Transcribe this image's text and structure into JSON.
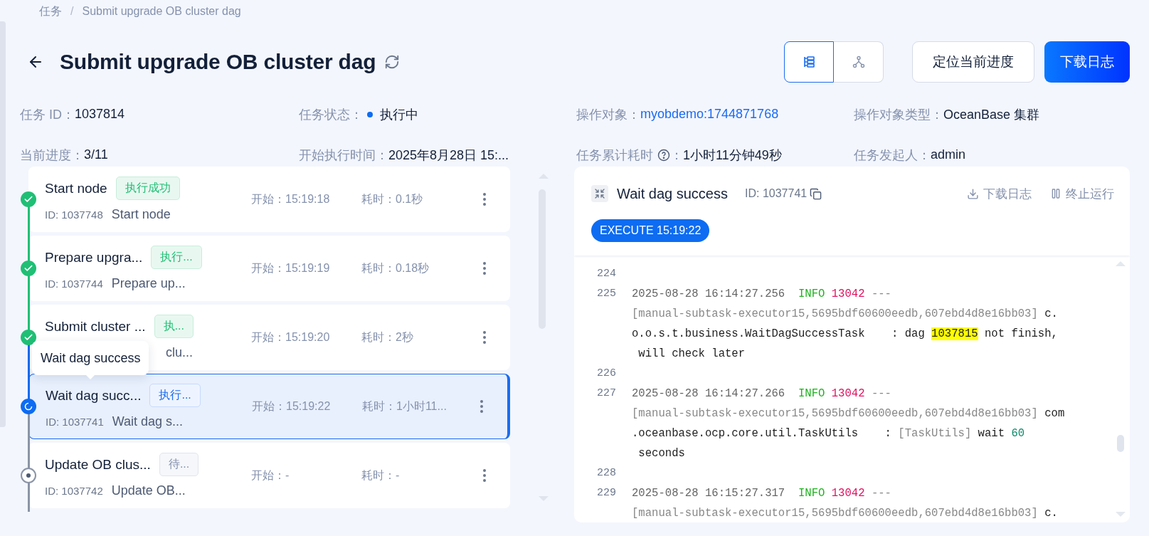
{
  "breadcrumb": [
    {
      "label": "任务"
    },
    {
      "label": "Submit upgrade OB cluster dag"
    }
  ],
  "breadcrumb_separator": "/",
  "title": "Submit upgrade OB cluster dag",
  "view_toggle": [
    {
      "kind": "list",
      "selected": true
    },
    {
      "kind": "tree",
      "selected": false
    }
  ],
  "actions": [
    {
      "label": "定位当前进度",
      "kind": "default"
    },
    {
      "label": "下载日志",
      "kind": "primary"
    }
  ],
  "info": [
    {
      "label": "任务 ID：",
      "value": "1037814",
      "kind": "plain"
    },
    {
      "label": "任务状态：",
      "value": "执行中",
      "kind": "status",
      "color": "#0d6cf2"
    },
    {
      "label": "操作对象：",
      "value": "myobdemo:1744871768",
      "kind": "link"
    },
    {
      "label": "操作对象类型：",
      "value": "OceanBase 集群",
      "kind": "plain"
    },
    {
      "label": "当前进度：",
      "value": "3/11",
      "kind": "plain"
    },
    {
      "label": "开始执行时间：",
      "value": "2025年8月28日 15:...",
      "kind": "plain"
    },
    {
      "label": "任务累计耗时",
      "colon": "：",
      "value": "1小时11分钟49秒",
      "kind": "help"
    },
    {
      "label": "任务发起人：",
      "value": "admin",
      "kind": "plain"
    }
  ],
  "nodes": [
    {
      "kind": "success",
      "title": "Start node",
      "badge": "执行成功",
      "id": "ID: 1037748",
      "desc": "Start node",
      "start": "开始：15:19:18",
      "duration": "耗时：0.1秒",
      "selected": false
    },
    {
      "kind": "success",
      "title": "Prepare upgra...",
      "badge": "执行...",
      "id": "ID: 1037744",
      "desc": "Prepare up...",
      "start": "开始：15:19:19",
      "duration": "耗时：0.18秒",
      "selected": false
    },
    {
      "kind": "success",
      "title": "Submit cluster ...",
      "badge": "执...",
      "desc": "clu...",
      "start": "开始：15:19:20",
      "duration": "耗时：2秒",
      "selected": false
    },
    {
      "kind": "running",
      "title": "Wait dag succ...",
      "badge": "执行...",
      "id": "ID: 1037741",
      "desc": "Wait dag s...",
      "start": "开始：15:19:22",
      "duration": "耗时：1小时11...",
      "selected": true
    },
    {
      "kind": "pending",
      "title": "Update OB clus...",
      "badge": "待...",
      "id": "ID: 1037742",
      "desc": "Update OB...",
      "start": "开始：-",
      "duration": "耗时：-",
      "selected": false
    }
  ],
  "node_tooltip": "Wait dag success",
  "log_panel": {
    "title": "Wait dag success",
    "id": "ID: 1037741",
    "actions": [
      {
        "kind": "download",
        "label": "下载日志"
      },
      {
        "kind": "stop",
        "label": "终止运行"
      }
    ],
    "execute": "EXECUTE 15:19:22",
    "lines": [
      {
        "number": "224"
      },
      {
        "number": "225",
        "segments": [
          {
            "kind": "time",
            "text": "2025-08-28 16:14:27.256"
          },
          {
            "kind": "level",
            "text": "  INFO"
          },
          {
            "kind": "pid",
            "text": " 13042"
          },
          {
            "kind": "dim",
            "text": " ---"
          },
          {
            "kind": "dim",
            "text": "[manual-subtask-executor15,5695bdf60600eedb,607ebd4d8e16bb03]",
            "wrap": true
          },
          {
            "kind": "text",
            "text": " c."
          },
          {
            "kind": "text",
            "text": "o.o.s.t.business.WaitDagSuccessTask    : dag ",
            "wrap": true
          },
          {
            "kind": "highlight",
            "text": "1037815"
          },
          {
            "kind": "text",
            "text": " not finish,"
          },
          {
            "kind": "text",
            "text": " will check later",
            "wrap": true
          }
        ]
      },
      {
        "number": "226"
      },
      {
        "number": "227",
        "segments": [
          {
            "kind": "time",
            "text": "2025-08-28 16:14:27.266"
          },
          {
            "kind": "level",
            "text": "  INFO"
          },
          {
            "kind": "pid",
            "text": " 13042"
          },
          {
            "kind": "dim",
            "text": " ---"
          },
          {
            "kind": "dim",
            "text": "[manual-subtask-executor15,5695bdf60600eedb,607ebd4d8e16bb03]",
            "wrap": true
          },
          {
            "kind": "text",
            "text": " com"
          },
          {
            "kind": "text",
            "text": ".oceanbase.ocp.core.util.TaskUtils    : ",
            "wrap": true
          },
          {
            "kind": "dim",
            "text": "[TaskUtils]"
          },
          {
            "kind": "text",
            "text": " wait "
          },
          {
            "kind": "number",
            "text": "60"
          },
          {
            "kind": "text",
            "text": " seconds",
            "wrap": true
          }
        ]
      },
      {
        "number": "228"
      },
      {
        "number": "229",
        "segments": [
          {
            "kind": "time",
            "text": "2025-08-28 16:15:27.317"
          },
          {
            "kind": "level",
            "text": "  INFO"
          },
          {
            "kind": "pid",
            "text": " 13042"
          },
          {
            "kind": "dim",
            "text": " ---"
          },
          {
            "kind": "dim",
            "text": "[manual-subtask-executor15,5695bdf60600eedb,607ebd4d8e16bb03]",
            "wrap": true
          },
          {
            "kind": "text",
            "text": " c."
          }
        ]
      }
    ]
  }
}
